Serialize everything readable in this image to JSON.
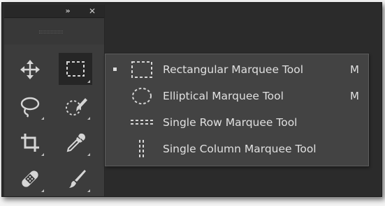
{
  "panel": {
    "collapse_glyph": "»",
    "close_glyph": "✕"
  },
  "tools": [
    {
      "name": "move-tool",
      "icon": "move-icon",
      "active": false,
      "has_flyout": false
    },
    {
      "name": "rectangular-marquee-tool",
      "icon": "rect-marquee-icon",
      "active": true,
      "has_flyout": true
    },
    {
      "name": "lasso-tool",
      "icon": "lasso-icon",
      "active": false,
      "has_flyout": true
    },
    {
      "name": "quick-selection-tool",
      "icon": "quick-selection-icon",
      "active": false,
      "has_flyout": true
    },
    {
      "name": "crop-tool",
      "icon": "crop-icon",
      "active": false,
      "has_flyout": true
    },
    {
      "name": "eyedropper-tool",
      "icon": "eyedropper-icon",
      "active": false,
      "has_flyout": true
    },
    {
      "name": "healing-brush-tool",
      "icon": "bandage-icon",
      "active": false,
      "has_flyout": true
    },
    {
      "name": "brush-tool",
      "icon": "brush-icon",
      "active": false,
      "has_flyout": true
    }
  ],
  "flyout": {
    "items": [
      {
        "label": "Rectangular Marquee Tool",
        "shortcut": "M",
        "selected": true,
        "icon": "rect-marquee-icon"
      },
      {
        "label": "Elliptical Marquee Tool",
        "shortcut": "M",
        "selected": false,
        "icon": "ellipse-marquee-icon"
      },
      {
        "label": "Single Row Marquee Tool",
        "shortcut": "",
        "selected": false,
        "icon": "single-row-marquee-icon"
      },
      {
        "label": "Single Column Marquee Tool",
        "shortcut": "",
        "selected": false,
        "icon": "single-column-marquee-icon"
      }
    ]
  },
  "colors": {
    "panel_bg": "#3c3c3c",
    "flyout_bg": "#434343",
    "text": "#e0e0e0",
    "icon": "#d6d6d6"
  }
}
